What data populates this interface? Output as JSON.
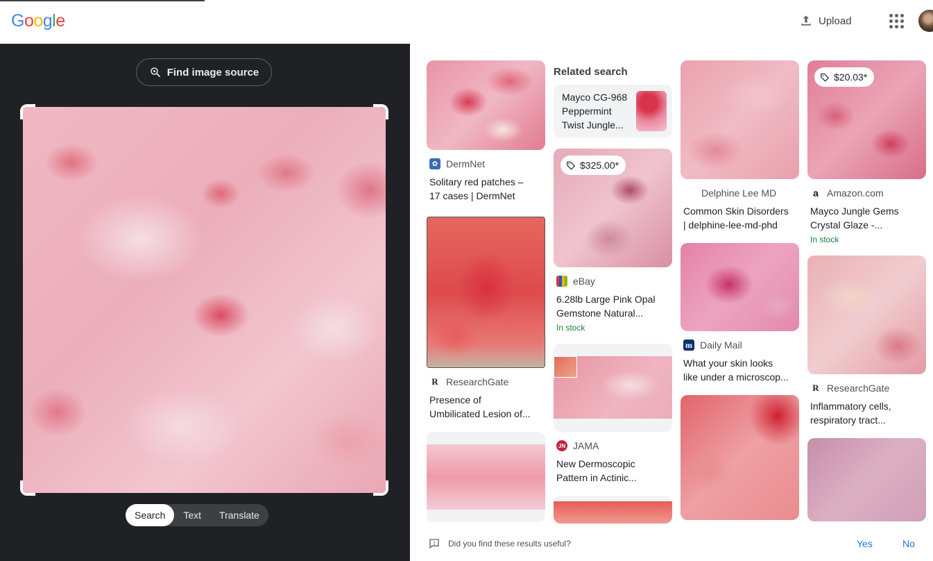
{
  "header": {
    "logo": "Google",
    "upload_label": "Upload"
  },
  "left_panel": {
    "find_source_label": "Find image source",
    "modes": [
      "Search",
      "Text",
      "Translate"
    ],
    "active_mode": "Search"
  },
  "results": {
    "columns": [
      [
        {
          "source": "DermNet",
          "title_lines": [
            "Solitary red patches –",
            "17 cases | DermNet"
          ]
        },
        {
          "source": "ResearchGate",
          "title_lines": [
            "Presence of",
            "Umbilicated Lesion of..."
          ]
        },
        {
          "source": "",
          "title_lines": []
        }
      ],
      [
        {
          "price": "$325.00*",
          "source": "eBay",
          "title_lines": [
            "6.28lb Large Pink Opal",
            "Gemstone Natural..."
          ],
          "stock": "In stock"
        },
        {
          "source": "JAMA",
          "title_lines": [
            "New Dermoscopic",
            "Pattern in Actinic..."
          ]
        }
      ],
      [
        {
          "source": "Delphine Lee MD",
          "title_lines": [
            "Common Skin Disorders",
            "| delphine-lee-md-phd"
          ]
        },
        {
          "source": "Daily Mail",
          "title_lines": [
            "What your skin looks",
            "like under a microscop..."
          ]
        }
      ],
      [
        {
          "price": "$20.03*",
          "source": "Amazon.com",
          "title_lines": [
            "Mayco Jungle Gems",
            "Crystal Glaze -..."
          ],
          "stock": "In stock"
        },
        {
          "source": "ResearchGate",
          "title_lines": [
            "Inflammatory cells,",
            "respiratory tract..."
          ]
        }
      ]
    ],
    "related": {
      "heading": "Related search",
      "text_lines": [
        "Mayco CG-968",
        "Peppermint",
        "Twist Jungle..."
      ]
    }
  },
  "feedback": {
    "question": "Did you find these results useful?",
    "yes": "Yes",
    "no": "No"
  },
  "colors": {
    "panel_dark": "#202124",
    "link_blue": "#1a73e8",
    "stock_green": "#188038"
  }
}
